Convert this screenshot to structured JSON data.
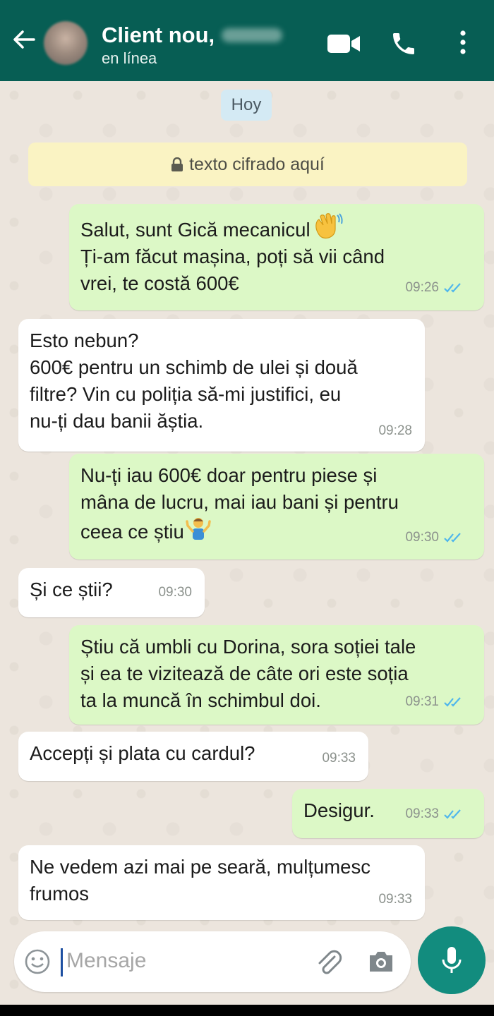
{
  "header": {
    "contact_name": "Client nou,",
    "status": "en línea",
    "icons": [
      "back-arrow-icon",
      "video-call-icon",
      "phone-icon",
      "more-vert-icon"
    ],
    "color": "#075E54"
  },
  "chat": {
    "date_label": "Hoy",
    "encryption_notice": "texto cifrado aquí",
    "messages": [
      {
        "dir": "out",
        "lines": [
          "Salut, sunt Gică mecanicul",
          "Ți-am făcut mașina, poți să vii când",
          "vrei, te costă 600€"
        ],
        "emoji": "waving-hand",
        "time": "09:26",
        "read": true
      },
      {
        "dir": "in",
        "lines": [
          "Esto nebun?",
          "600€ pentru un schimb de ulei și două",
          "filtre? Vin cu poliția să-mi justifici, eu",
          "nu-ți dau banii ăștia."
        ],
        "time": "09:28"
      },
      {
        "dir": "out",
        "lines": [
          "Nu-ți iau 600€ doar pentru piese și",
          "mâna de lucru, mai iau bani și pentru",
          "ceea ce știu"
        ],
        "emoji": "person-shrugging",
        "time": "09:30",
        "read": true
      },
      {
        "dir": "in",
        "lines": [
          "Și ce știi?"
        ],
        "time": "09:30"
      },
      {
        "dir": "out",
        "lines": [
          "Știu că umbli cu Dorina, sora soției tale",
          "și ea te vizitează de câte ori este soția",
          "ta la muncă în schimbul doi."
        ],
        "time": "09:31",
        "read": true
      },
      {
        "dir": "in",
        "lines": [
          "Accepți și plata cu cardul?"
        ],
        "time": "09:33"
      },
      {
        "dir": "out",
        "lines": [
          "Desigur."
        ],
        "time": "09:33",
        "read": true
      },
      {
        "dir": "in",
        "lines": [
          "Ne vedem azi mai pe seară, mulțumesc",
          "frumos"
        ],
        "time": "09:33"
      }
    ]
  },
  "composer": {
    "placeholder": "Mensaje",
    "icons": [
      "emoji-icon",
      "attach-clip-icon",
      "camera-icon",
      "mic-icon"
    ],
    "mic_color": "#128C7E"
  },
  "colors": {
    "outgoing_bubble": "#DCF8C6",
    "incoming_bubble": "#FFFFFF",
    "read_ticks": "#4FB6EC",
    "chat_bg": "#ECE5DD"
  }
}
